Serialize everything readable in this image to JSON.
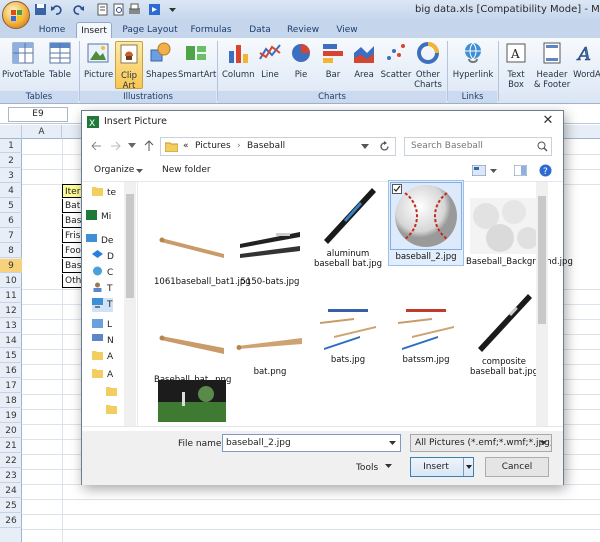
{
  "window": {
    "title": "big data.xls  [Compatibility Mode] - Mic"
  },
  "tabs": [
    "Home",
    "Insert",
    "Page Layout",
    "Formulas",
    "Data",
    "Review",
    "View"
  ],
  "ribbon": {
    "buttons": [
      {
        "label": "PivotTable",
        "icon": "pivottable-icon"
      },
      {
        "label": "Table",
        "icon": "table-icon"
      },
      {
        "label": "Picture",
        "icon": "picture-icon"
      },
      {
        "label": "Clip Art",
        "icon": "clipart-icon"
      },
      {
        "label": "Shapes",
        "icon": "shapes-icon"
      },
      {
        "label": "SmartArt",
        "icon": "smartart-icon"
      },
      {
        "label": "Column",
        "icon": "column-chart-icon"
      },
      {
        "label": "Line",
        "icon": "line-chart-icon"
      },
      {
        "label": "Pie",
        "icon": "pie-chart-icon"
      },
      {
        "label": "Bar",
        "icon": "bar-chart-icon"
      },
      {
        "label": "Area",
        "icon": "area-chart-icon"
      },
      {
        "label": "Scatter",
        "icon": "scatter-chart-icon"
      },
      {
        "label": "Other Charts",
        "icon": "other-charts-icon"
      },
      {
        "label": "Hyperlink",
        "icon": "hyperlink-icon"
      },
      {
        "label": "Text Box",
        "icon": "textbox-icon"
      },
      {
        "label": "Header & Footer",
        "icon": "header-footer-icon"
      },
      {
        "label": "WordA",
        "icon": "wordart-icon"
      }
    ],
    "groups": [
      "Tables",
      "Illustrations",
      "Charts",
      "Links"
    ]
  },
  "formula_bar": {
    "name_box": "E9"
  },
  "sheet": {
    "columns": [
      "A"
    ],
    "rows": [
      "1",
      "2",
      "3",
      "4",
      "5",
      "6",
      "7",
      "8",
      "9",
      "10",
      "11",
      "12",
      "13",
      "14",
      "15",
      "16",
      "17",
      "18",
      "19",
      "20",
      "21",
      "22",
      "23",
      "24",
      "25",
      "26"
    ],
    "cells": [
      "Iter",
      "Bat",
      "Bas",
      "Fris",
      "Foo",
      "Bas",
      "Oth"
    ]
  },
  "dialog": {
    "title": "Insert Picture",
    "path": [
      "«",
      "Pictures",
      "Baseball"
    ],
    "search_placeholder": "Search Baseball",
    "organize_label": "Organize",
    "newfolder_label": "New folder",
    "nav_items": [
      "te",
      "Mi",
      "De",
      "D",
      "C",
      "T",
      "T",
      "L",
      "N",
      "A",
      "A"
    ],
    "files": [
      {
        "name": "1061baseball_bat1.jpg"
      },
      {
        "name": "5150-bats.jpg"
      },
      {
        "name": "aluminum baseball bat.jpg"
      },
      {
        "name": "baseball_2.jpg"
      },
      {
        "name": "Baseball_Background.jpg"
      },
      {
        "name": "Baseball_bat_.png"
      },
      {
        "name": "bat.png"
      },
      {
        "name": "bats.jpg"
      },
      {
        "name": "batssm.jpg"
      },
      {
        "name": "composite baseball bat.jpg"
      },
      {
        "name": ""
      }
    ],
    "filename_label": "File name:",
    "filename_value": "baseball_2.jpg",
    "filetype_value": "All Pictures (*.emf;*.wmf;*.jpg;*",
    "tools_label": "Tools",
    "insert_label": "Insert",
    "cancel_label": "Cancel"
  },
  "colors": {
    "accent": "#f8c653",
    "selection": "#dceafb"
  }
}
